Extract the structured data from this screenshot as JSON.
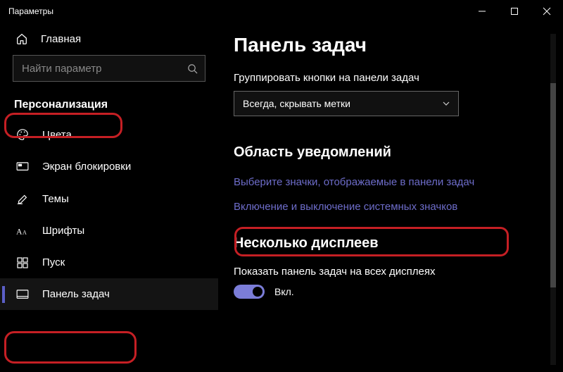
{
  "window": {
    "title": "Параметры"
  },
  "sidebar": {
    "home": "Главная",
    "search_placeholder": "Найти параметр",
    "category": "Персонализация",
    "items": [
      {
        "label": "Цвета"
      },
      {
        "label": "Экран блокировки"
      },
      {
        "label": "Темы"
      },
      {
        "label": "Шрифты"
      },
      {
        "label": "Пуск"
      },
      {
        "label": "Панель задач"
      }
    ]
  },
  "main": {
    "title": "Панель задач",
    "group_label": "Группировать кнопки на панели задач",
    "group_value": "Всегда, скрывать метки",
    "notif_heading": "Область уведомлений",
    "link_select_icons": "Выберите значки, отображаемые в панели задач",
    "link_system_icons": "Включение и выключение системных значков",
    "multi_heading": "Несколько дисплеев",
    "multi_label": "Показать панель задач на всех дисплеях",
    "toggle_on": "Вкл."
  }
}
